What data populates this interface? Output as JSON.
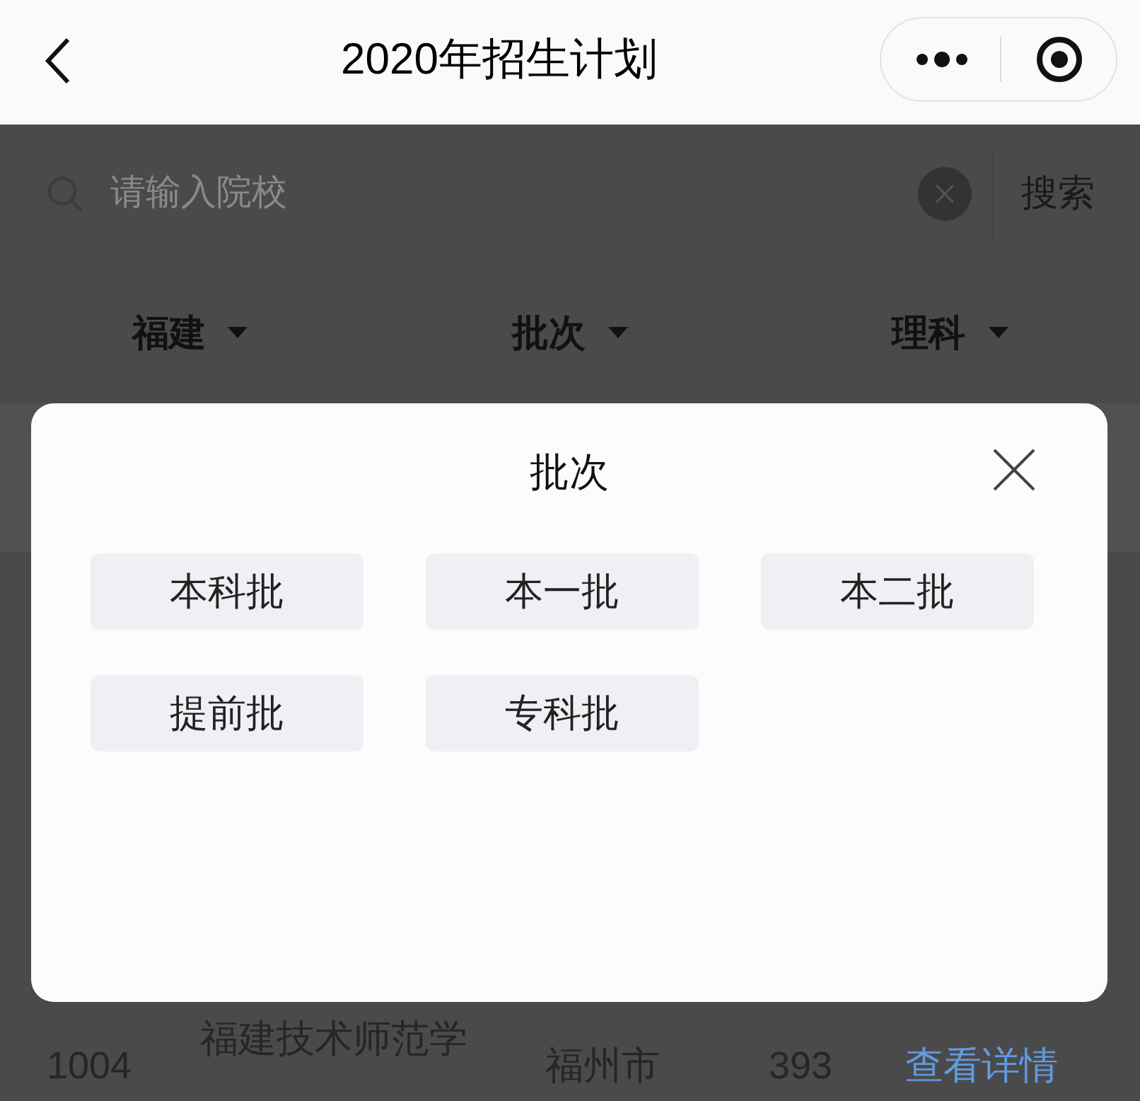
{
  "header": {
    "title": "2020年招生计划"
  },
  "search": {
    "placeholder": "请输入院校",
    "button": "搜索"
  },
  "filters": [
    {
      "label": "福建"
    },
    {
      "label": "批次"
    },
    {
      "label": "理科"
    }
  ],
  "table_row": {
    "code": "1004",
    "school": "福建技术师范学",
    "city": "福州市",
    "count": "393",
    "link": "查看详情"
  },
  "modal": {
    "title": "批次",
    "options": [
      {
        "label": "本科批",
        "selected": false
      },
      {
        "label": "本一批",
        "selected": false
      },
      {
        "label": "本二批",
        "selected": false
      },
      {
        "label": "提前批",
        "selected": false
      },
      {
        "label": "专科批",
        "selected": false
      }
    ]
  }
}
